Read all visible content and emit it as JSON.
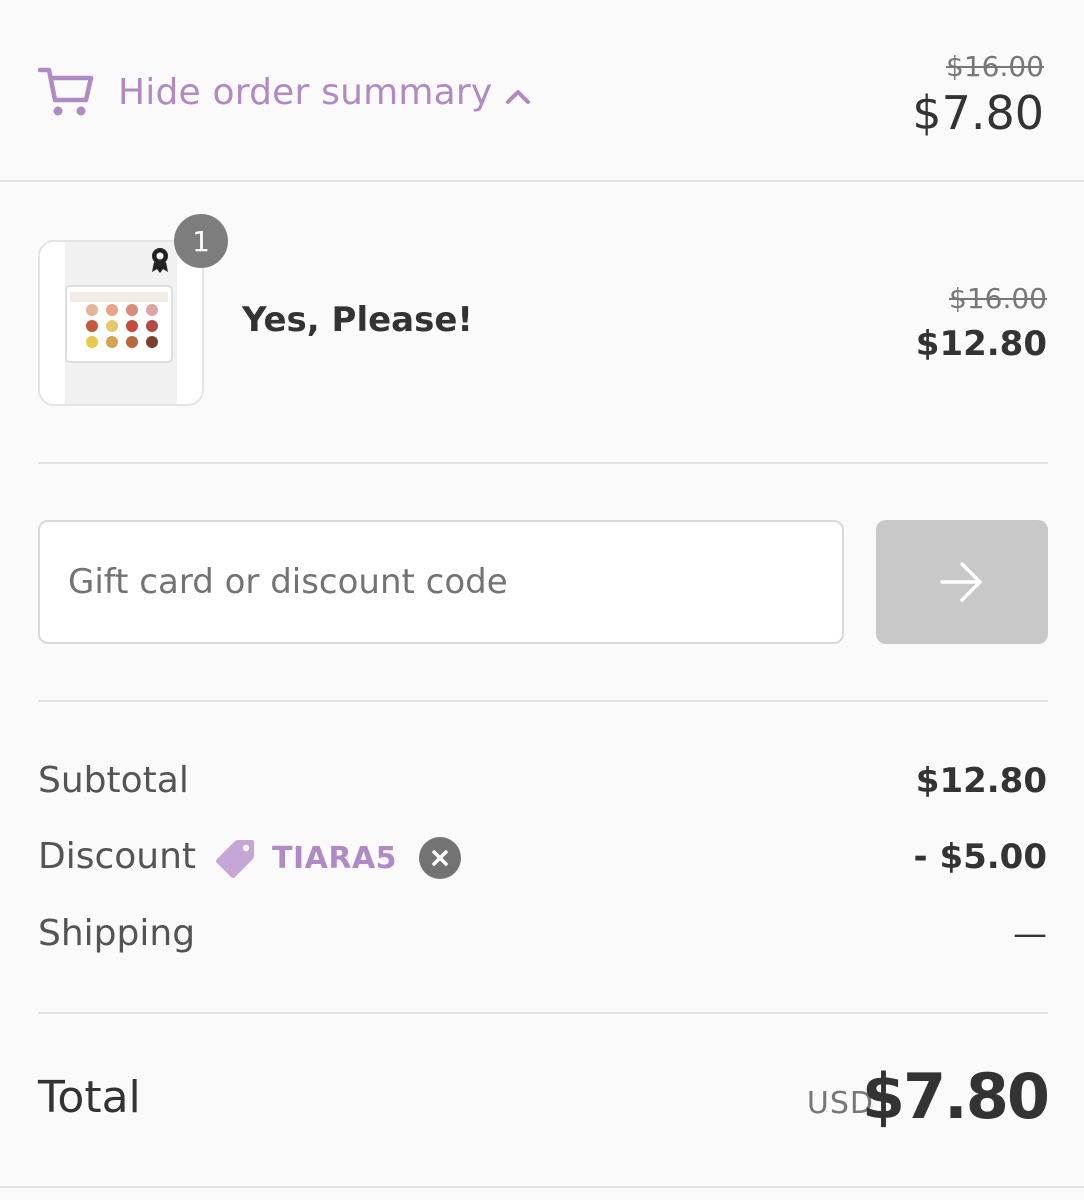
{
  "summary_toggle": {
    "label": "Hide order summary",
    "compare_total": "$16.00",
    "total": "$7.80"
  },
  "line_item": {
    "name": "Yes, Please!",
    "quantity": "1",
    "compare_price": "$16.00",
    "price": "$12.80"
  },
  "discount_form": {
    "placeholder": "Gift card or discount code",
    "value": ""
  },
  "totals": {
    "subtotal_label": "Subtotal",
    "subtotal_value": "$12.80",
    "discount_label": "Discount",
    "discount_code": "TIARA5",
    "discount_value": "- $5.00",
    "shipping_label": "Shipping",
    "shipping_value": "—",
    "total_label": "Total",
    "currency": "USD",
    "total_value": "$7.80"
  },
  "colors": {
    "accent": "#b08ac4",
    "text": "#333333",
    "muted": "#737373",
    "button_disabled": "#c8c8c8",
    "divider": "#e1e1e1"
  },
  "icons": {
    "cart": "cart-icon",
    "chevron": "chevron-up-icon",
    "arrow": "arrow-right-icon",
    "tag": "tag-icon",
    "remove": "close-icon"
  }
}
